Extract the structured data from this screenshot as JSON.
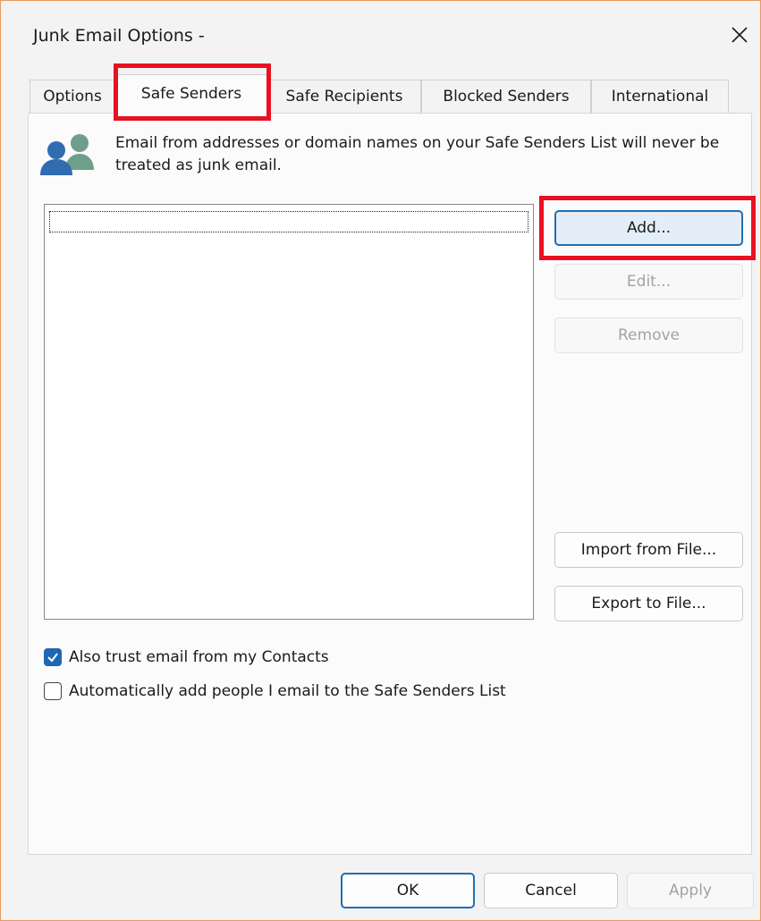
{
  "window": {
    "title": "Junk Email Options -",
    "close_glyph": "✕"
  },
  "tabs": [
    {
      "label": "Options",
      "active": false
    },
    {
      "label": "Safe Senders",
      "active": true
    },
    {
      "label": "Safe Recipients",
      "active": false
    },
    {
      "label": "Blocked Senders",
      "active": false
    },
    {
      "label": "International",
      "active": false
    }
  ],
  "panel": {
    "icon": "people-icon",
    "description": "Email from addresses or domain names on your Safe Senders List will never be treated as junk email.",
    "list_items": []
  },
  "side_buttons": {
    "add": "Add...",
    "edit": "Edit...",
    "remove": "Remove",
    "import": "Import from File...",
    "export": "Export to File..."
  },
  "options": {
    "trust_contacts": {
      "label": "Also trust email from my Contacts",
      "checked": true
    },
    "auto_add": {
      "label": "Automatically add people I email to the Safe Senders List",
      "checked": false
    }
  },
  "footer": {
    "ok": "OK",
    "cancel": "Cancel",
    "apply": "Apply"
  },
  "colors": {
    "highlight": "#e81123",
    "accent": "#1e67b4",
    "window_border": "#e79a5c"
  }
}
